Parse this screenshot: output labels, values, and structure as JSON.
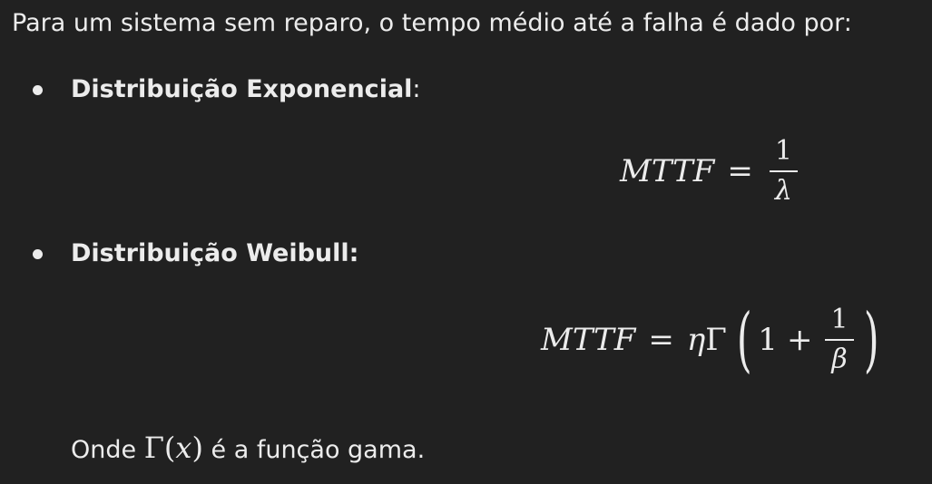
{
  "intro": "Para um sistema sem reparo, o tempo médio até a falha é dado por:",
  "bullets": [
    {
      "label": "Distribuição Exponencial",
      "suffix": ":",
      "formula": {
        "lhs": "MTTF",
        "op": "=",
        "numerator": "1",
        "denominator": "λ"
      }
    },
    {
      "label": "Distribuição Weibull:",
      "suffix": "",
      "formula": {
        "lhs": "MTTF",
        "op": "=",
        "eta": "η",
        "gamma": "Γ",
        "open_paren": "(",
        "one": "1",
        "plus": "+",
        "numerator": "1",
        "denominator": "β",
        "close_paren": ")"
      }
    }
  ],
  "where": {
    "prefix": "Onde ",
    "gamma": "Γ",
    "arg_open": "(",
    "arg": "x",
    "arg_close": ")",
    "suffix": " é a função gama."
  }
}
